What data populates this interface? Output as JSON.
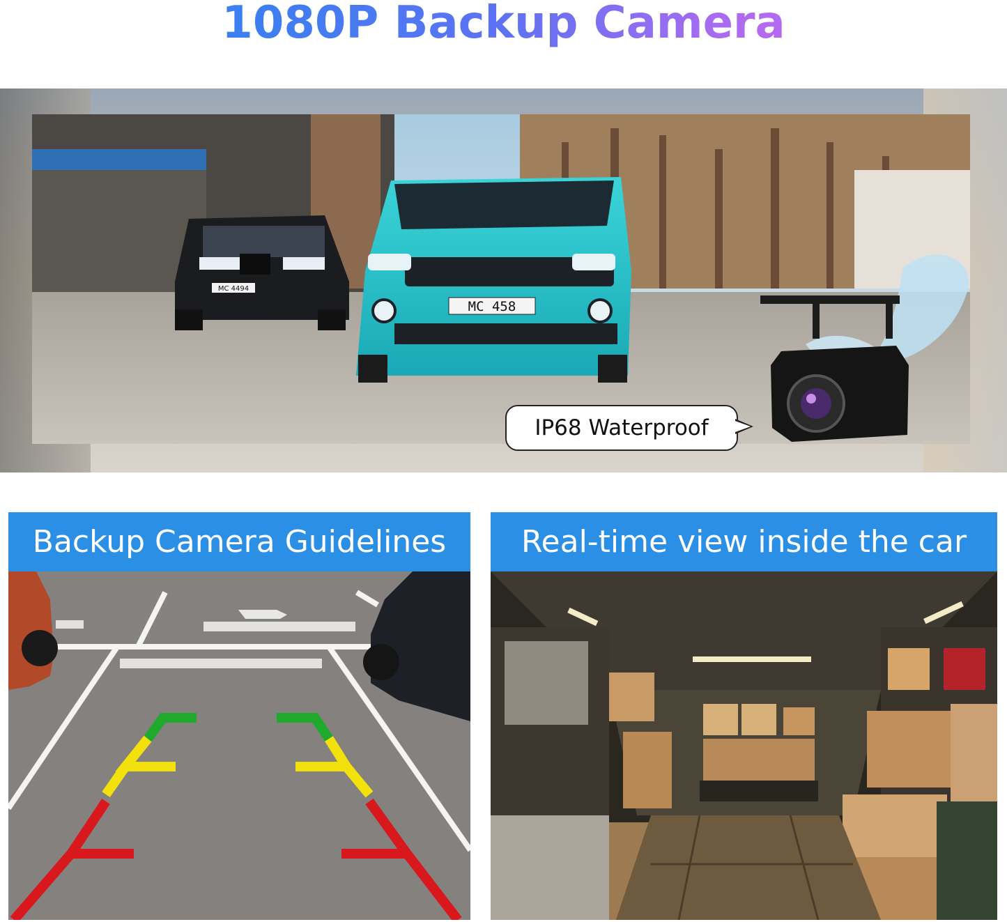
{
  "title": "1080P Backup Camera",
  "hero": {
    "caption": "IP68 Waterproof",
    "plate_front": "MC 458",
    "plate_rear": "MC 4494"
  },
  "panels": [
    {
      "heading": "Backup Camera Guidelines"
    },
    {
      "heading": "Real-time view inside the car"
    }
  ],
  "colors": {
    "title_gradient_start": "#3b7ff0",
    "title_gradient_end": "#b46af0",
    "panel_header": "#2b8fe6",
    "guide_green": "#1faa2e",
    "guide_yellow": "#f2e10c",
    "guide_red": "#d8181c"
  }
}
